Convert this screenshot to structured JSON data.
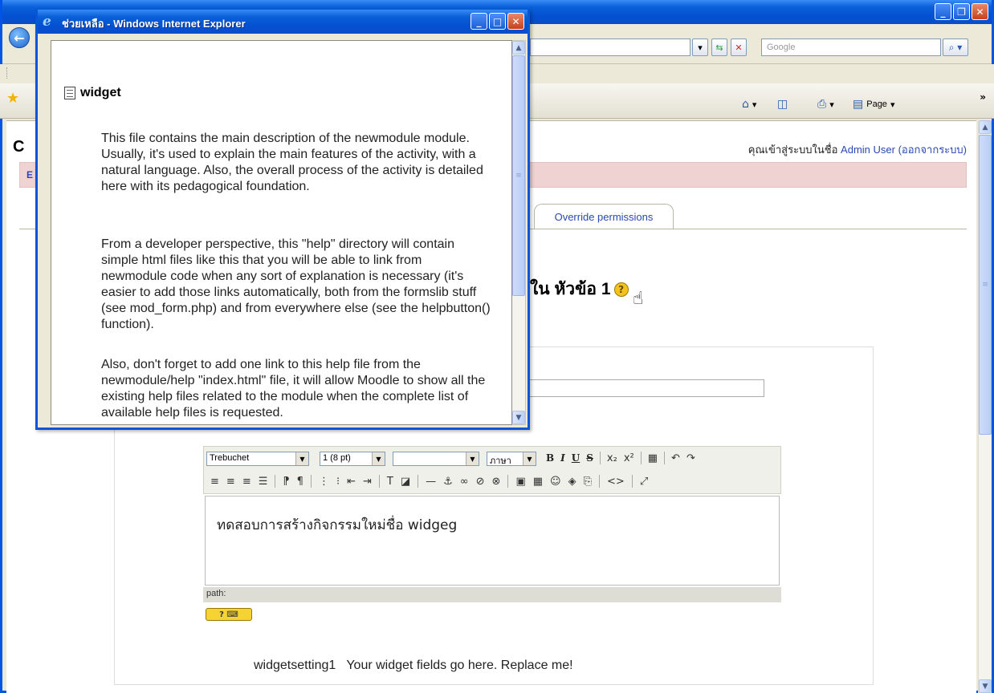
{
  "browser": {
    "search_placeholder": "Google",
    "page_menu": "Page"
  },
  "page": {
    "heading_letter": "C",
    "breadcrumb_letter": "E",
    "login_prefix": "คุณเข้าสู่ระบบในชื่อ ",
    "login_user": "Admin User",
    "logout_link": "(ออกจากระบบ)",
    "override_tab": "Override permissions",
    "adding_heading": "ใน หัวข้อ 1",
    "editor_text": "ทดสอบการสร้างกิจกรรมใหม่ชื่อ widgeg",
    "path_label": "path:",
    "widget_setting_label": "widgetsetting1",
    "widget_setting_text": "Your widget fields go here. Replace me!"
  },
  "editor": {
    "font_family": "Trebuchet",
    "font_size": "1 (8 pt)",
    "lang": "ภาษา"
  },
  "help_popup": {
    "title": "ช่วยเหลือ - Windows Internet Explorer",
    "heading": "widget",
    "paragraphs": [
      "This file contains the main description of the newmodule module. Usually, it's used to explain the main features of the activity, with a natural language. Also, the overall process of the activity is detailed here with its pedagogical foundation.",
      "From a developer perspective, this \"help\" directory will contain simple html files like this that you will be able to link from newmodule code when any sort of explanation is necessary (it's easier to add those links automatically, both from the formslib stuff (see mod_form.php) and from everywhere else (see the helpbutton() function).",
      "Also, don't forget to add one link to this help file from the newmodule/help \"index.html\" file, it will allow Moodle to show all the existing help files related to the module when the complete list of available help files is requested."
    ]
  }
}
